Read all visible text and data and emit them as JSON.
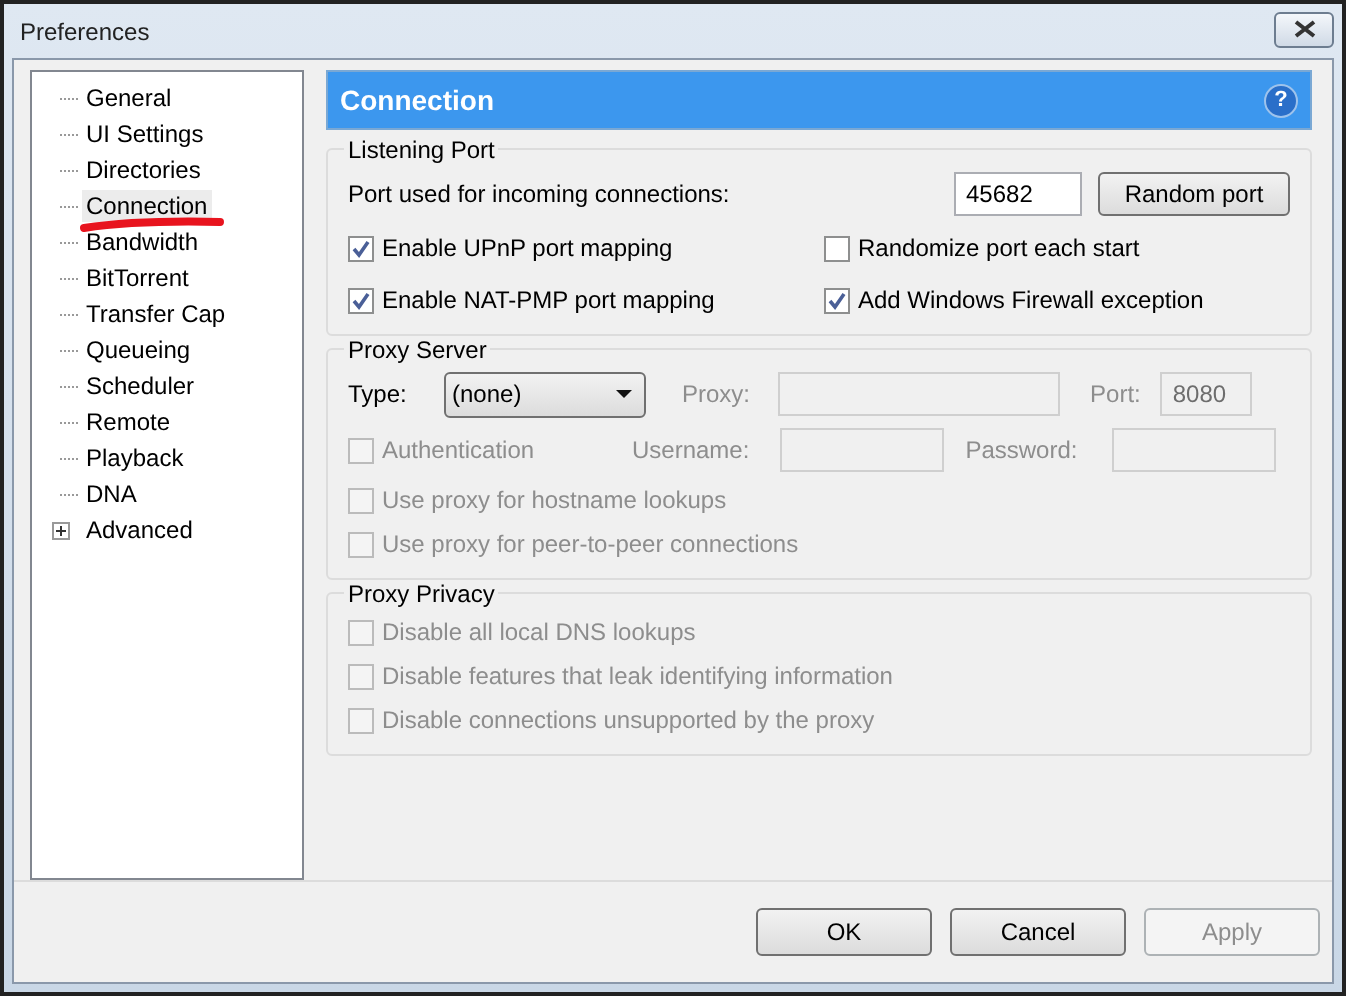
{
  "window": {
    "title": "Preferences"
  },
  "sidebar": {
    "items": [
      {
        "label": "General",
        "selected": false,
        "marked": false,
        "kind": "leaf"
      },
      {
        "label": "UI Settings",
        "selected": false,
        "marked": false,
        "kind": "leaf"
      },
      {
        "label": "Directories",
        "selected": false,
        "marked": false,
        "kind": "leaf"
      },
      {
        "label": "Connection",
        "selected": true,
        "marked": true,
        "kind": "leaf"
      },
      {
        "label": "Bandwidth",
        "selected": false,
        "marked": false,
        "kind": "leaf"
      },
      {
        "label": "BitTorrent",
        "selected": false,
        "marked": false,
        "kind": "leaf"
      },
      {
        "label": "Transfer Cap",
        "selected": false,
        "marked": false,
        "kind": "leaf"
      },
      {
        "label": "Queueing",
        "selected": false,
        "marked": false,
        "kind": "leaf"
      },
      {
        "label": "Scheduler",
        "selected": false,
        "marked": false,
        "kind": "leaf"
      },
      {
        "label": "Remote",
        "selected": false,
        "marked": false,
        "kind": "leaf"
      },
      {
        "label": "Playback",
        "selected": false,
        "marked": false,
        "kind": "leaf"
      },
      {
        "label": "DNA",
        "selected": false,
        "marked": false,
        "kind": "leaf"
      },
      {
        "label": "Advanced",
        "selected": false,
        "marked": false,
        "kind": "collapsed"
      }
    ]
  },
  "header": {
    "title": "Connection",
    "help": "?"
  },
  "listening_port": {
    "title": "Listening Port",
    "port_label": "Port used for incoming connections:",
    "port_value": "45682",
    "random_button": "Random port",
    "checkboxes": [
      {
        "label": "Enable UPnP port mapping",
        "checked": true,
        "disabled": false
      },
      {
        "label": "Randomize port each start",
        "checked": false,
        "disabled": false
      },
      {
        "label": "Enable NAT-PMP port mapping",
        "checked": true,
        "disabled": false
      },
      {
        "label": "Add Windows Firewall exception",
        "checked": true,
        "disabled": false
      }
    ]
  },
  "proxy_server": {
    "title": "Proxy Server",
    "type_label": "Type:",
    "type_value": "(none)",
    "proxy_label": "Proxy:",
    "port_label": "Port:",
    "port_value": "8080",
    "username_label": "Username:",
    "password_label": "Password:",
    "fields_disabled": true,
    "authentication": {
      "label": "Authentication",
      "checked": false,
      "disabled": true
    },
    "checkboxes": [
      {
        "label": "Use proxy for hostname lookups",
        "checked": false,
        "disabled": true
      },
      {
        "label": "Use proxy for peer-to-peer connections",
        "checked": false,
        "disabled": true
      }
    ]
  },
  "proxy_privacy": {
    "title": "Proxy Privacy",
    "checkboxes": [
      {
        "label": "Disable all local DNS lookups",
        "checked": false,
        "disabled": true
      },
      {
        "label": "Disable features that leak identifying information",
        "checked": false,
        "disabled": true
      },
      {
        "label": "Disable connections unsupported by the proxy",
        "checked": false,
        "disabled": true
      }
    ]
  },
  "buttons": [
    {
      "label": "OK",
      "disabled": false
    },
    {
      "label": "Cancel",
      "disabled": false
    },
    {
      "label": "Apply",
      "disabled": true
    }
  ]
}
